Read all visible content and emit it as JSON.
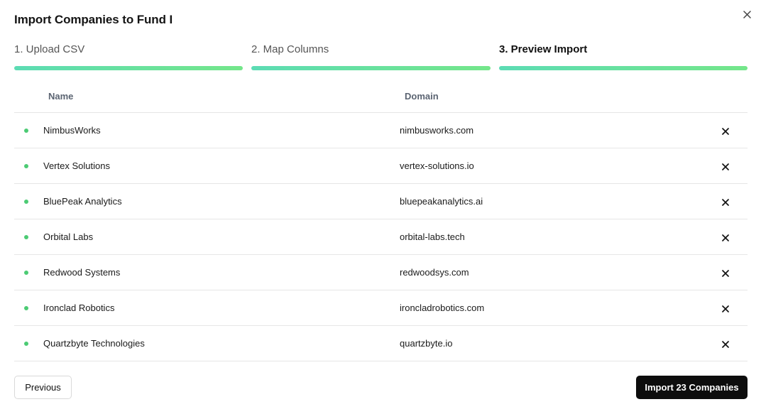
{
  "modal": {
    "title": "Import Companies to Fund I"
  },
  "steps": [
    {
      "label": "1. Upload CSV",
      "state": "complete"
    },
    {
      "label": "2. Map Columns",
      "state": "complete"
    },
    {
      "label": "3. Preview Import",
      "state": "active"
    }
  ],
  "table": {
    "headers": {
      "name": "Name",
      "domain": "Domain"
    },
    "rows": [
      {
        "name": "NimbusWorks",
        "domain": "nimbusworks.com"
      },
      {
        "name": "Vertex Solutions",
        "domain": "vertex-solutions.io"
      },
      {
        "name": "BluePeak Analytics",
        "domain": "bluepeakanalytics.ai"
      },
      {
        "name": "Orbital Labs",
        "domain": "orbital-labs.tech"
      },
      {
        "name": "Redwood Systems",
        "domain": "redwoodsys.com"
      },
      {
        "name": "Ironclad Robotics",
        "domain": "ironcladrobotics.com"
      },
      {
        "name": "Quartzbyte Technologies",
        "domain": "quartzbyte.io"
      }
    ]
  },
  "footer": {
    "previous_label": "Previous",
    "import_label": "Import 23 Companies"
  },
  "colors": {
    "progress_start": "#5cdcb4",
    "progress_end": "#74e68a",
    "status_dot": "#4ccb74",
    "primary_button": "#0d0d0d"
  },
  "icons": {
    "close": "close-icon",
    "remove_row": "x-icon",
    "status": "status-dot"
  }
}
